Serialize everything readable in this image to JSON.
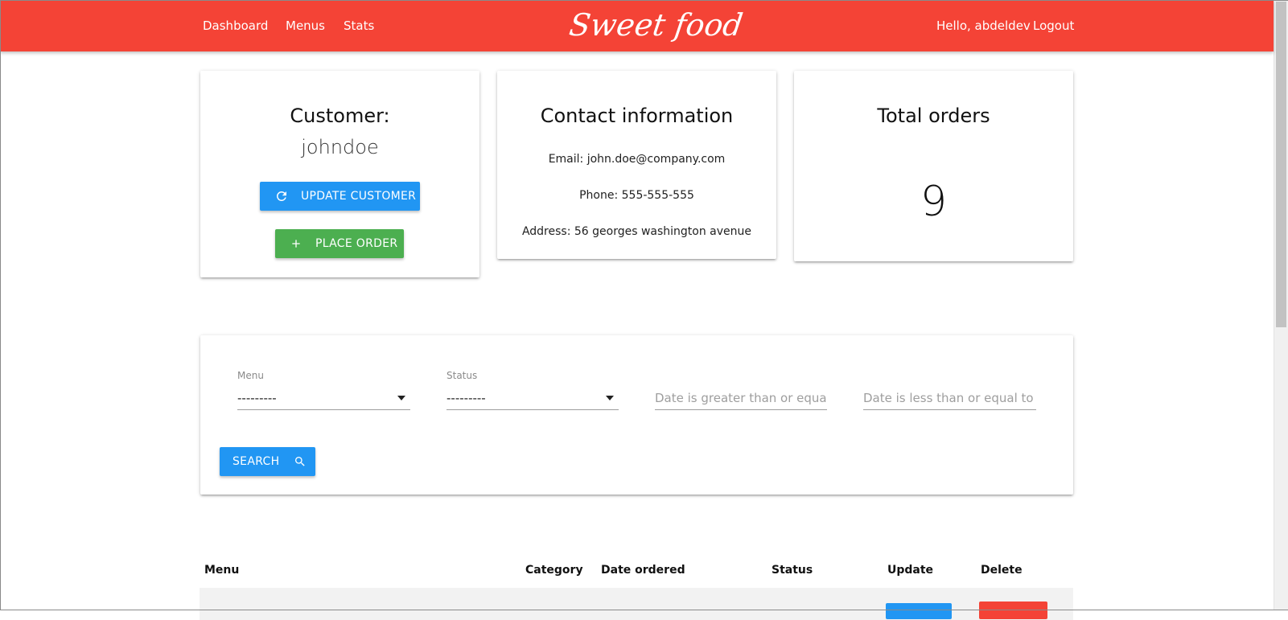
{
  "navbar": {
    "links": [
      "Dashboard",
      "Menus",
      "Stats"
    ],
    "brand": "Sweet food",
    "greeting": "Hello, abdeldev",
    "logout": "Logout"
  },
  "customer_card": {
    "title": "Customer:",
    "name": "johndoe",
    "update_button": "UPDATE CUSTOMER",
    "place_order_button": "PLACE ORDER",
    "update_icon": "refresh-icon",
    "place_order_icon": "plus-icon"
  },
  "contact_card": {
    "title": "Contact information",
    "email": "Email: john.doe@company.com",
    "phone": "Phone: 555-555-555",
    "address": "Address: 56 georges washington avenue"
  },
  "orders_card": {
    "title": "Total orders",
    "count": "9"
  },
  "filters": {
    "menu_label": "Menu",
    "menu_value": "---------",
    "status_label": "Status",
    "status_value": "---------",
    "date_gte_placeholder": "Date is greater than or equal to",
    "date_lte_placeholder": "Date is less than or equal to",
    "search_button": "SEARCH",
    "search_icon": "search-icon"
  },
  "table": {
    "headers": [
      "Menu",
      "Category",
      "Date ordered",
      "Status",
      "Update",
      "Delete"
    ]
  },
  "colors": {
    "navbar": "#f44336",
    "primary_button": "#2196f3",
    "success_button": "#4caf50",
    "danger_button": "#f44336"
  }
}
